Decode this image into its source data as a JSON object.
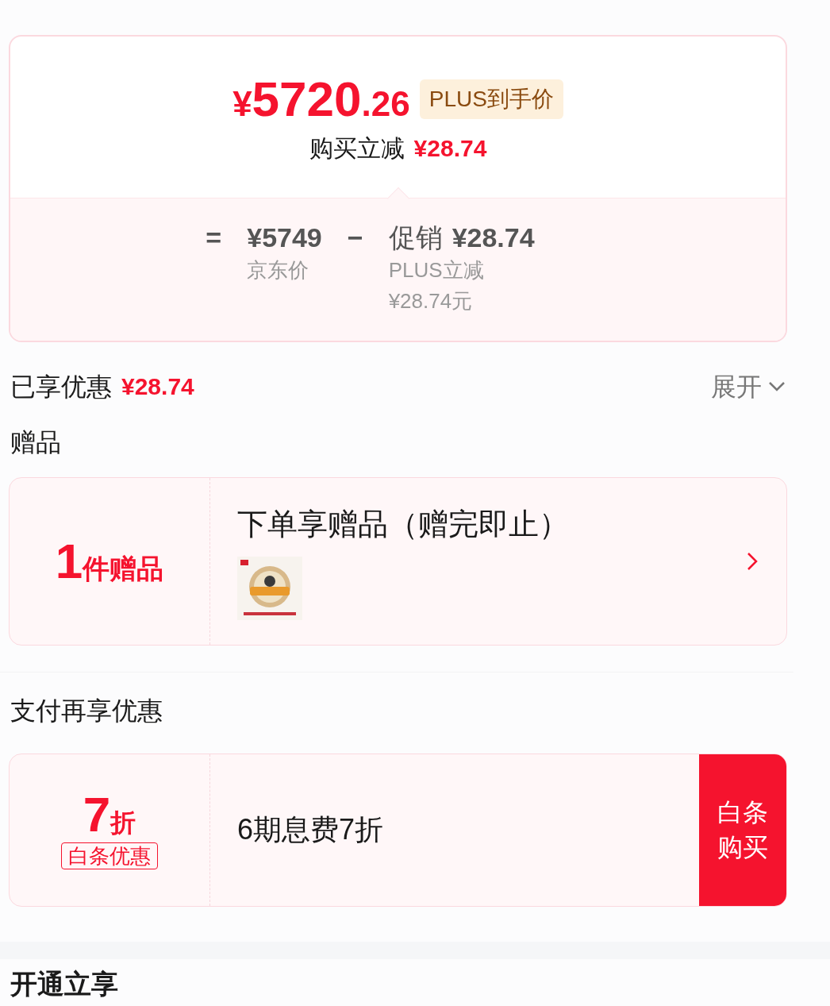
{
  "price": {
    "currency": "¥",
    "integer": "5720",
    "decimal": ".26",
    "badge": "PLUS到手价"
  },
  "instant_discount": {
    "label": "购买立减",
    "amount": "¥28.74"
  },
  "breakdown": {
    "equals": "=",
    "jd_price": {
      "value": "¥5749",
      "label": "京东价"
    },
    "minus": "−",
    "promo": {
      "label": "促销",
      "value": "¥28.74",
      "details": [
        "PLUS立减",
        "¥28.74元"
      ]
    }
  },
  "savings": {
    "label": "已享优惠",
    "amount": "¥28.74",
    "toggle": "展开",
    "expanded": false
  },
  "gifts": {
    "title": "赠品",
    "count": "1",
    "unit": "件赠品",
    "heading": "下单享赠品（赠完即止）"
  },
  "payment": {
    "title": "支付再享优惠",
    "offers": [
      {
        "discount": "7",
        "unit": "折",
        "tag": "白条优惠",
        "description": "6期息费7折",
        "action": [
          "白条",
          "购买"
        ]
      }
    ]
  },
  "next_section": {
    "title": "开通立享"
  }
}
